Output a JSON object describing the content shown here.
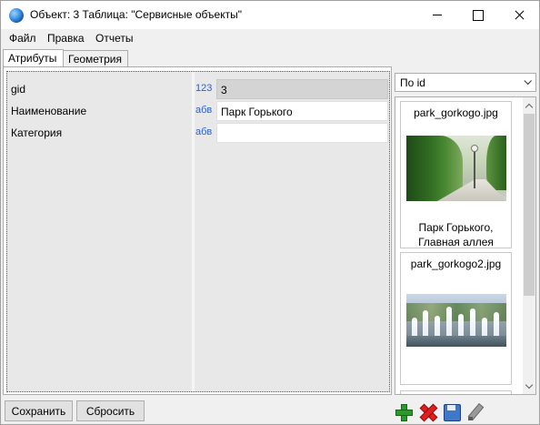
{
  "window": {
    "title": "Объект: 3 Таблица: \"Сервисные объекты\""
  },
  "menu": {
    "file": "Файл",
    "edit": "Правка",
    "reports": "Отчеты"
  },
  "tabs": [
    {
      "label": "Атрибуты",
      "active": true
    },
    {
      "label": "Геометрия",
      "active": false
    }
  ],
  "attributes": [
    {
      "name": "gid",
      "type": "123",
      "value": "3",
      "readonly": true
    },
    {
      "name": "Наименование",
      "type": "абв",
      "value": "Парк Горького",
      "readonly": false
    },
    {
      "name": "Категория",
      "type": "абв",
      "value": "",
      "readonly": false
    }
  ],
  "gallery": {
    "sort_label": "По id",
    "items": [
      {
        "file": "park_gorkogo.jpg",
        "caption_line1": "Парк Горького,",
        "caption_line2": "Главная аллея"
      },
      {
        "file": "park_gorkogo2.jpg",
        "caption_line1": "",
        "caption_line2": ""
      }
    ]
  },
  "buttons": {
    "save": "Сохранить",
    "reset": "Сбросить"
  },
  "icons": {
    "add": "plus-icon",
    "delete": "delete-icon",
    "save": "floppy-icon",
    "edit": "pencil-icon"
  },
  "colors": {
    "type_label": "#2b5fd0",
    "readonly_field": "#d4d4d4",
    "add_icon": "#2a9a2a",
    "delete_icon": "#e02020"
  }
}
